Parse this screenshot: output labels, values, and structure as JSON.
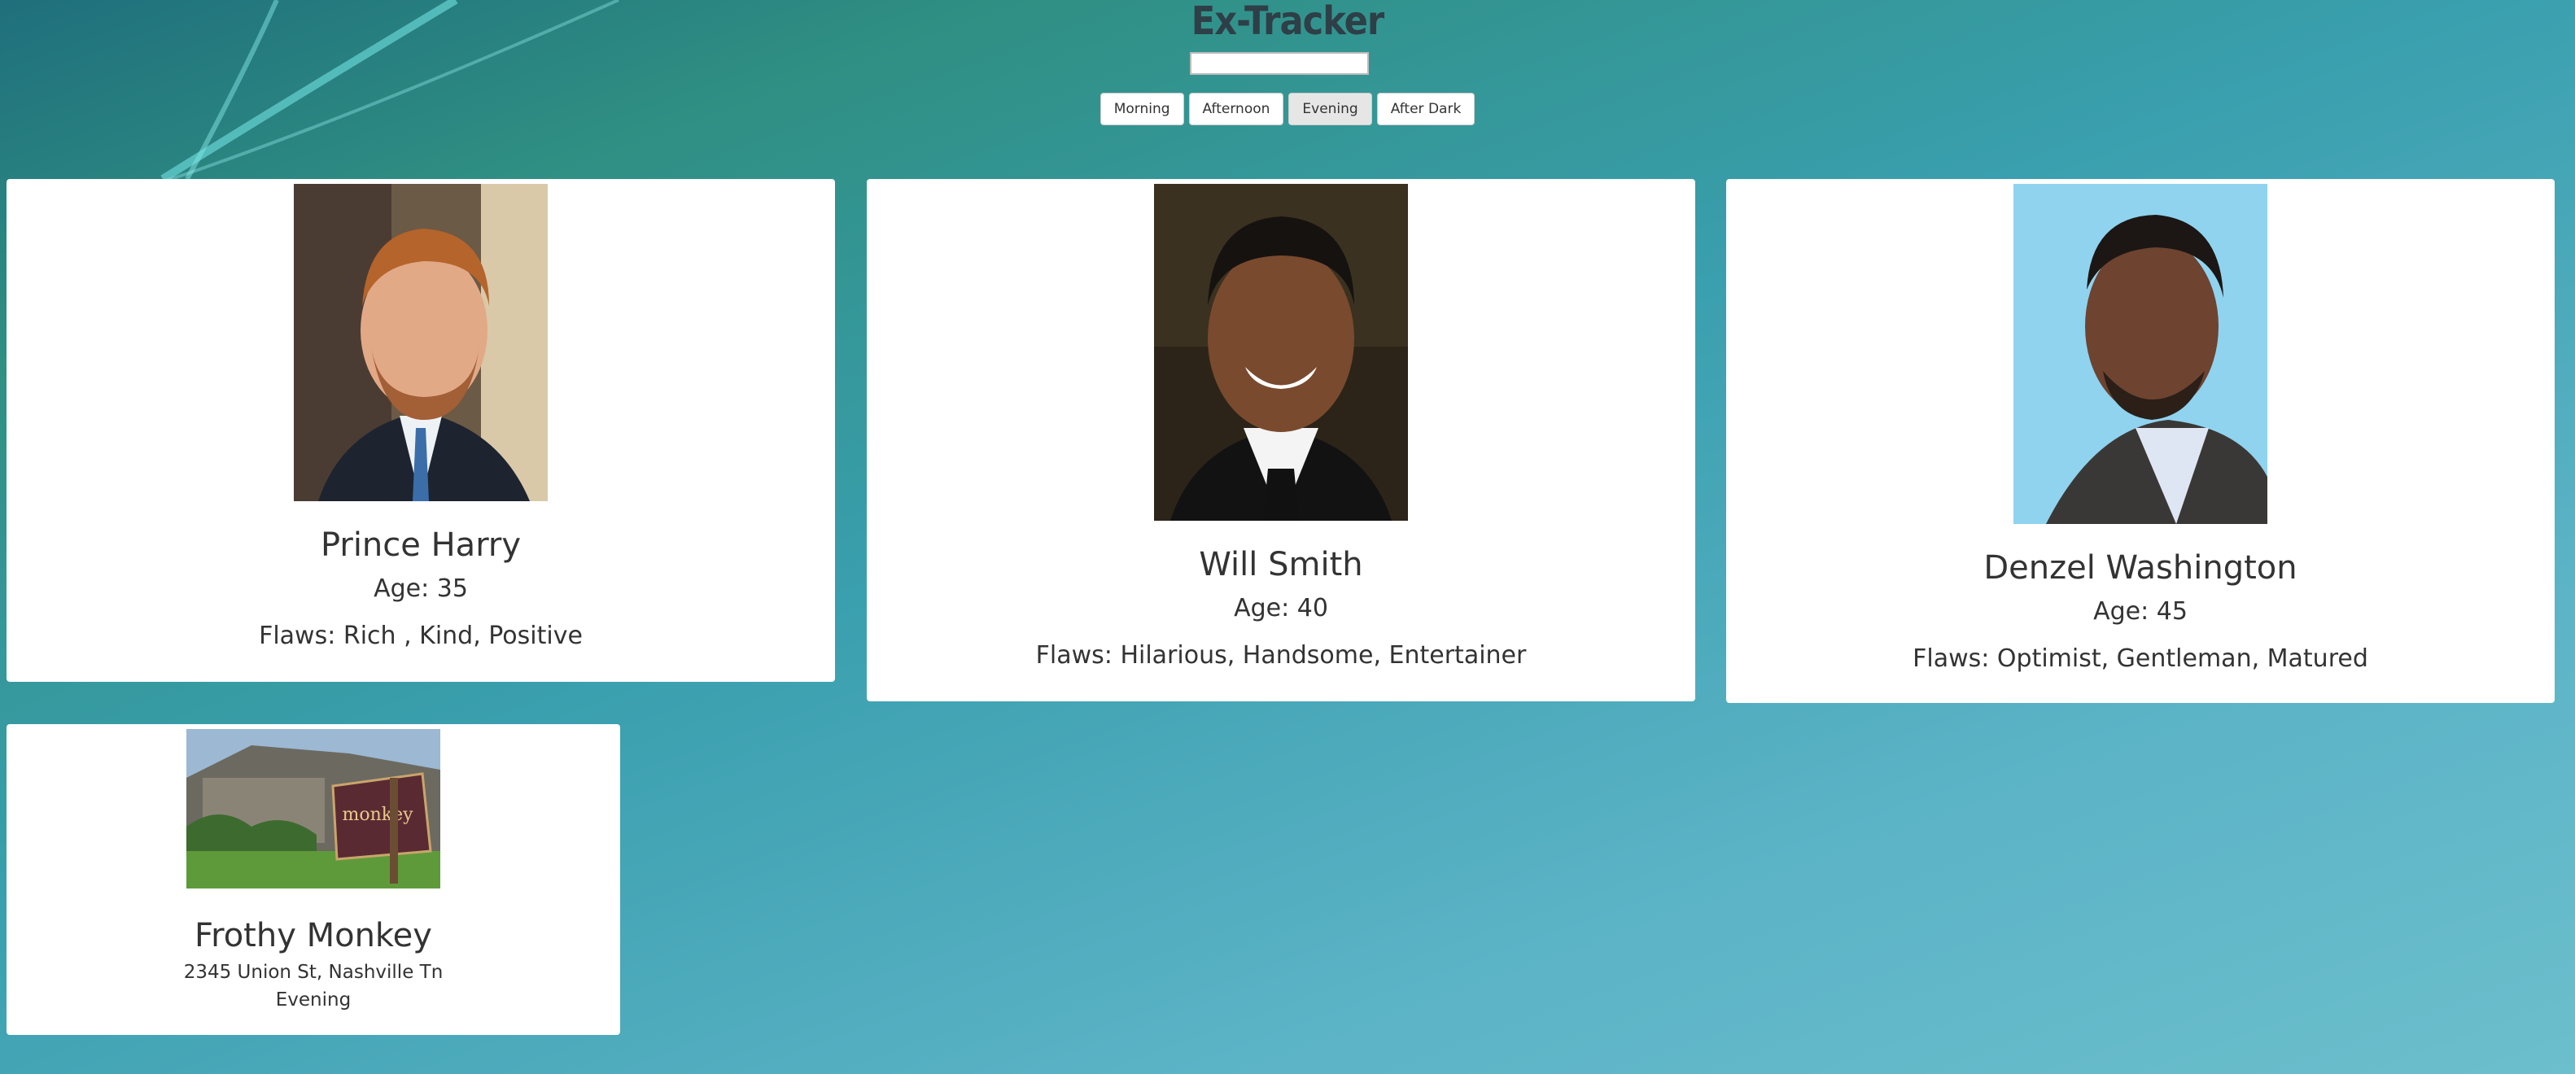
{
  "app": {
    "title": "Ex-Tracker"
  },
  "search": {
    "value": "",
    "placeholder": ""
  },
  "filters": [
    {
      "label": "Morning",
      "active": false
    },
    {
      "label": "Afternoon",
      "active": false
    },
    {
      "label": "Evening",
      "active": true
    },
    {
      "label": "After Dark",
      "active": false
    }
  ],
  "cards": [
    {
      "name": "Prince Harry",
      "age": "Age: 35",
      "flaws": "Flaws: Rich , Kind, Positive"
    },
    {
      "name": "Will Smith",
      "age": "Age: 40",
      "flaws": "Flaws: Hilarious, Handsome, Entertainer"
    },
    {
      "name": "Denzel Washington",
      "age": "Age: 45",
      "flaws": "Flaws: Optimist, Gentleman, Matured"
    }
  ],
  "place": {
    "name": "Frothy Monkey",
    "address": "2345 Union St, Nashville Tn",
    "time": "Evening",
    "sign_text": "monkey"
  }
}
